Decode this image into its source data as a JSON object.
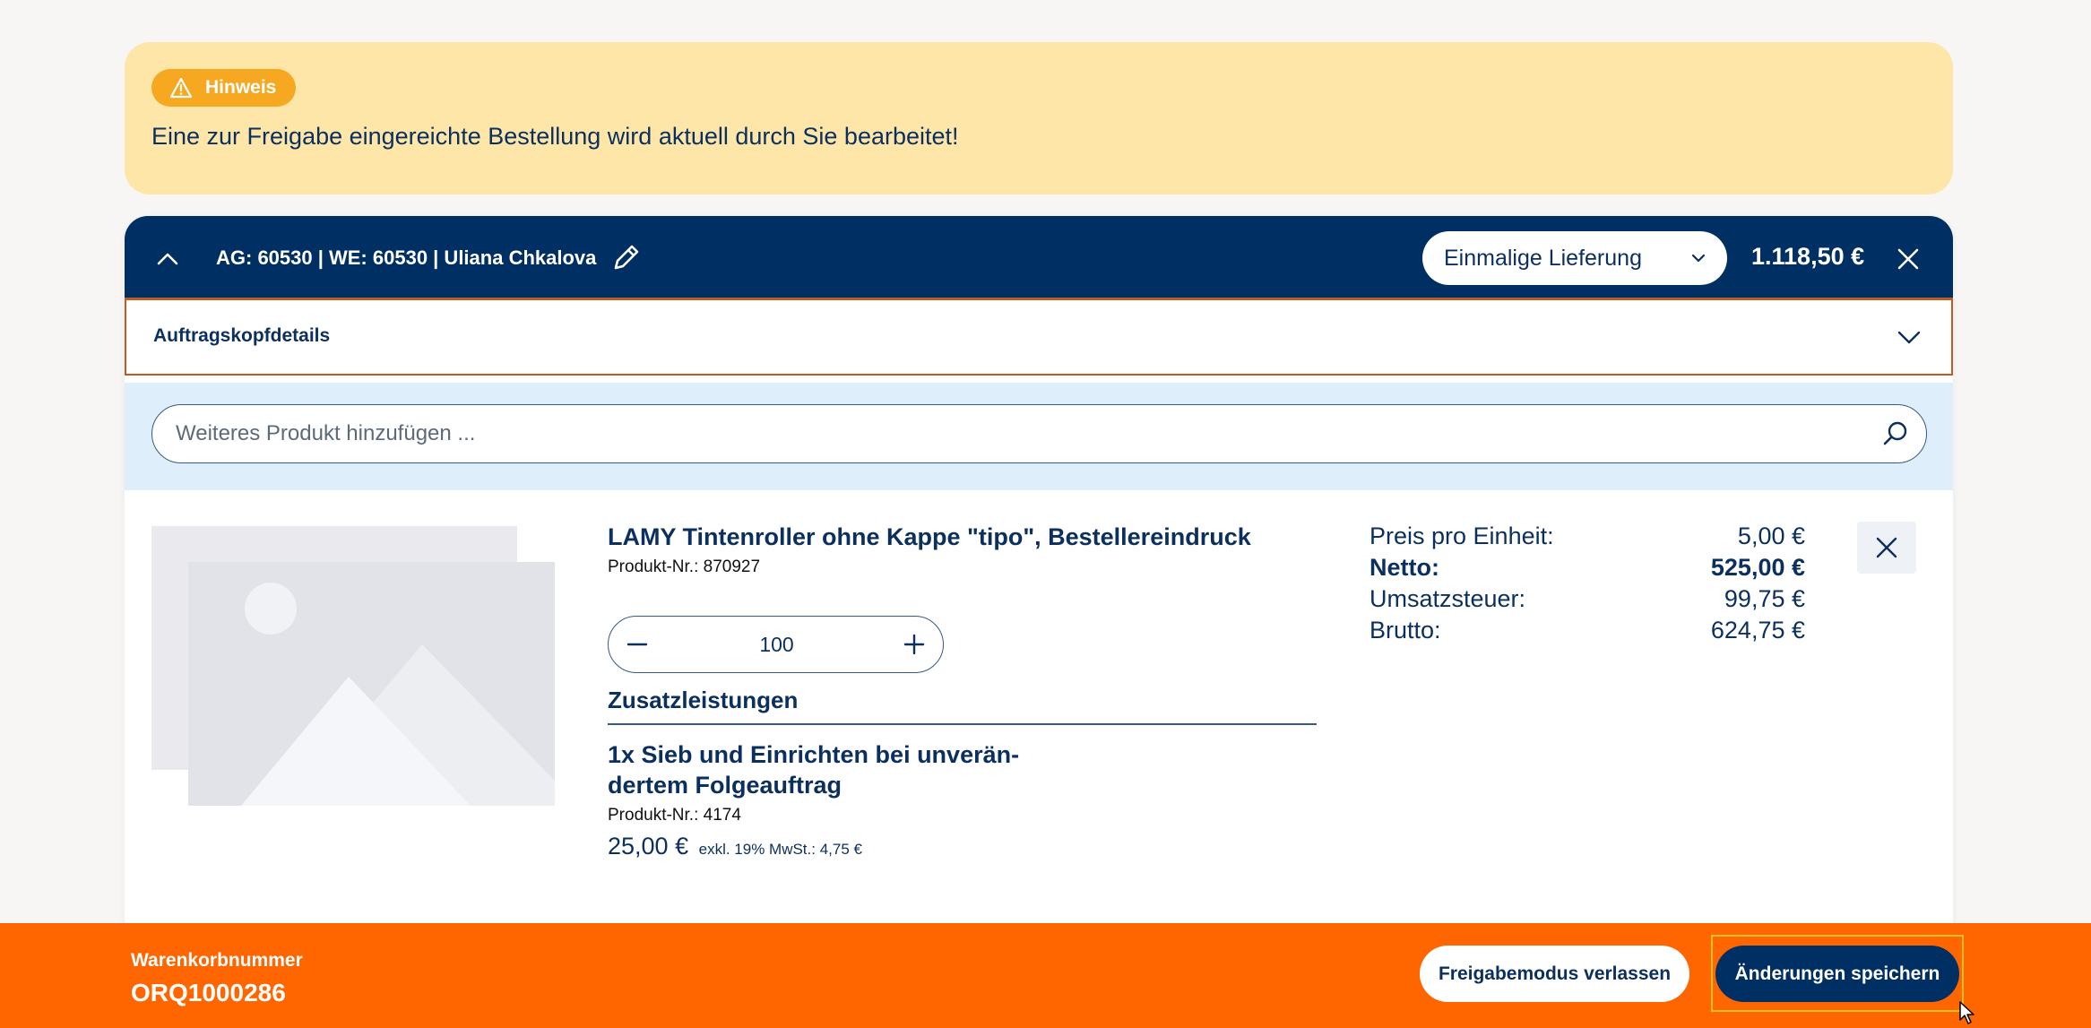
{
  "notice": {
    "badge": "Hinweis",
    "text": "Eine zur Freigabe eingereichte Bestellung wird aktuell durch Sie bearbeitet!"
  },
  "order": {
    "title": "AG: 60530 | WE: 60530 | Uliana Chkalova",
    "delivery": "Einmalige Lieferung",
    "total": "1.118,50 €",
    "details_label": "Auftragskopfdetails"
  },
  "search": {
    "placeholder": "Weiteres Produkt hinzufügen ..."
  },
  "product": {
    "title": "LAMY Tintenroller ohne Kappe \"tipo\", Bestellereindruck",
    "nr": "Produkt-Nr.: 870927",
    "quantity": "100",
    "extras_heading": "Zusatzleistungen",
    "extra": {
      "title": "1x Sieb und Einrichten bei unverän-dertem Folgeauftrag",
      "nr": "Produkt-Nr.: 4174",
      "price": "25,00 €",
      "tax": "exkl. 19% MwSt.: 4,75 €"
    },
    "prices": [
      {
        "label": "Preis pro Einheit:",
        "value": "5,00 €"
      },
      {
        "label": "Netto:",
        "value": "525,00 €"
      },
      {
        "label": "Umsatzsteuer:",
        "value": "99,75 €"
      },
      {
        "label": "Brutto:",
        "value": "624,75 €"
      }
    ]
  },
  "footer": {
    "cart_label": "Warenkorbnummer",
    "cart_number": "ORQ1000286",
    "leave_button": "Freigabemodus verlassen",
    "save_button": "Änderungen speichern"
  },
  "icons": {
    "warning": "warning-icon",
    "collapse": "chevron-up-icon",
    "edit": "pencil-icon",
    "select": "chevron-down-icon",
    "close": "close-icon",
    "search": "search-icon",
    "minus": "minus-icon",
    "plus": "plus-icon",
    "image": "image-placeholder-icon",
    "cursor": "mouse-cursor-icon"
  },
  "colors": {
    "navy": "#002f64",
    "orange": "#ff6600",
    "notice_bg": "#fde6a8",
    "badge": "#f6a821",
    "search_band": "#deeefb"
  }
}
